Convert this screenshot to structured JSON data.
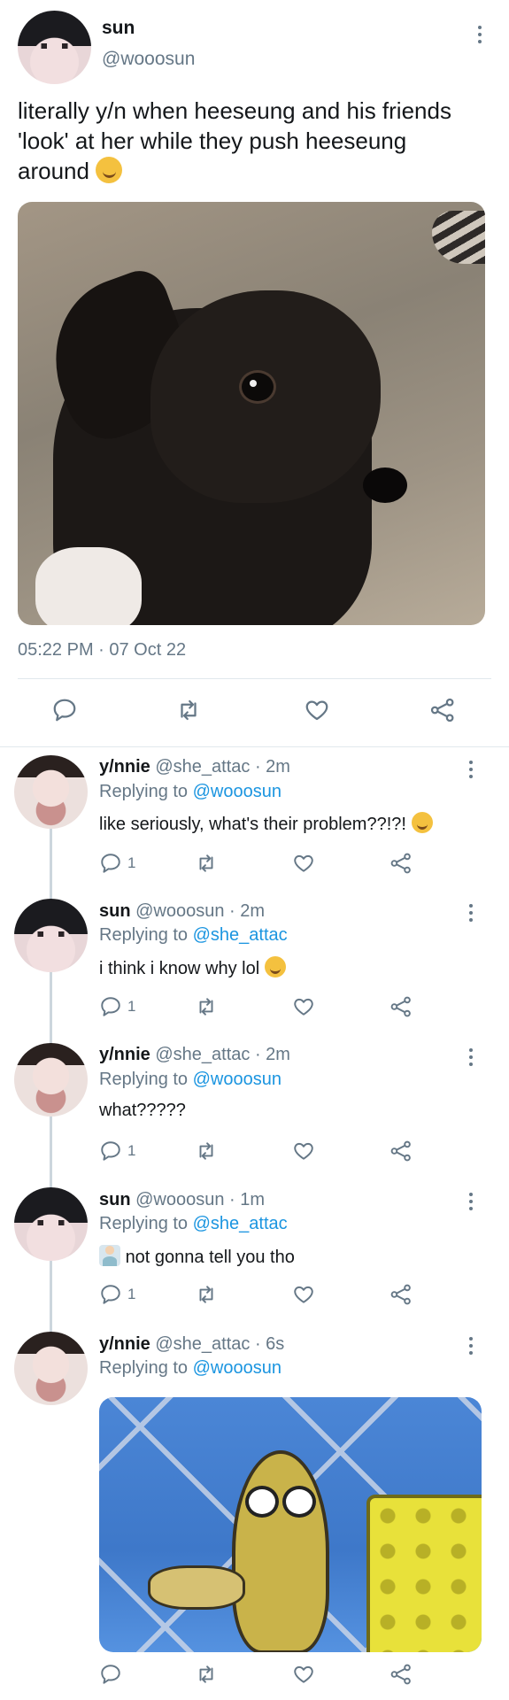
{
  "main_tweet": {
    "display_name": "sun",
    "handle": "@wooosun",
    "text": "literally y/n when heeseung and his friends 'look' at her while they push heeseung around",
    "timestamp": "05:22 PM · 07 Oct 22"
  },
  "replies": [
    {
      "display_name": "y/nnie",
      "meta": "@she_attac · 2m",
      "replying_prefix": "Replying to",
      "replying_to": "@wooosun",
      "text": "like seriously, what's their problem??!?!",
      "reply_count": "1"
    },
    {
      "display_name": "sun",
      "meta": "@wooosun · 2m",
      "replying_prefix": "Replying to",
      "replying_to": "@she_attac",
      "text": "i think i know why lol",
      "reply_count": "1"
    },
    {
      "display_name": "y/nnie",
      "meta": "@she_attac · 2m",
      "replying_prefix": "Replying to",
      "replying_to": "@wooosun",
      "text": "what?????",
      "reply_count": "1"
    },
    {
      "display_name": "sun",
      "meta": "@wooosun · 1m",
      "replying_prefix": "Replying to",
      "replying_to": "@she_attac",
      "text": "not gonna tell you tho",
      "reply_count": "1"
    },
    {
      "display_name": "y/nnie",
      "meta": "@she_attac · 6s",
      "replying_prefix": "Replying to",
      "replying_to": "@wooosun"
    }
  ],
  "icons": {
    "reply": "speech-bubble-icon",
    "retweet": "retweet-icon",
    "like": "heart-icon",
    "share": "share-icon",
    "more": "kebab-icon"
  },
  "colors": {
    "link": "#1b95e0",
    "muted": "#657786",
    "divider": "#e1e8ed"
  }
}
